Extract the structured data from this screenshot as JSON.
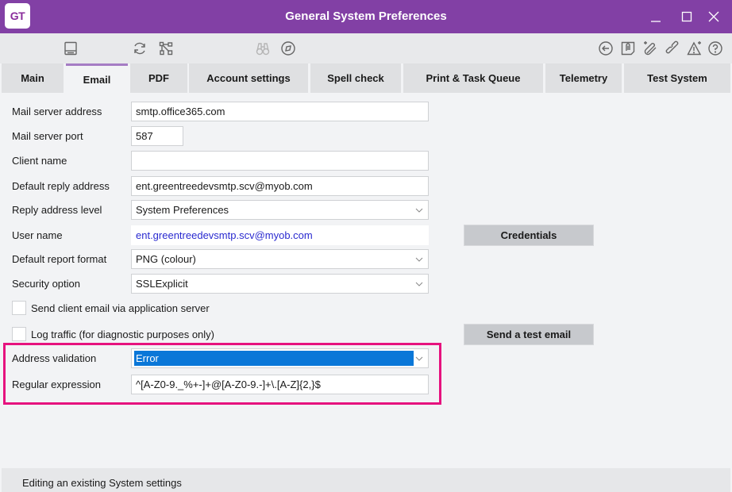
{
  "window": {
    "app_logo": "GT",
    "title": "General System Preferences",
    "controls": [
      "minimize",
      "maximize",
      "close"
    ]
  },
  "toolbar": {
    "left_icons": [
      {
        "name": "save-icon",
        "enabled": true
      },
      {
        "name": "refresh-icon",
        "enabled": true
      },
      {
        "name": "workflow-icon",
        "enabled": true
      },
      {
        "name": "binoculars-icon",
        "enabled": false
      },
      {
        "name": "compass-icon",
        "enabled": true
      }
    ],
    "right_icons": [
      {
        "name": "back-icon",
        "enabled": true
      },
      {
        "name": "attachment-doc-icon",
        "enabled": true
      },
      {
        "name": "add-attachment-icon",
        "enabled": true
      },
      {
        "name": "link-icon",
        "enabled": true
      },
      {
        "name": "add-alert-icon",
        "enabled": true
      },
      {
        "name": "help-icon",
        "enabled": true
      }
    ]
  },
  "tabs": [
    {
      "label": "Main",
      "active": false
    },
    {
      "label": "Email",
      "active": true
    },
    {
      "label": "PDF",
      "active": false
    },
    {
      "label": "Account settings",
      "active": false
    },
    {
      "label": "Spell check",
      "active": false
    },
    {
      "label": "Print & Task Queue",
      "active": false
    },
    {
      "label": "Telemetry",
      "active": false
    },
    {
      "label": "Test System",
      "active": false
    }
  ],
  "form": {
    "mail_server_address": {
      "label": "Mail server address",
      "value": "smtp.office365.com"
    },
    "mail_server_port": {
      "label": "Mail server port",
      "value": "587"
    },
    "client_name": {
      "label": "Client name",
      "value": ""
    },
    "default_reply_address": {
      "label": "Default reply address",
      "value": "ent.greentreedevsmtp.scv@myob.com"
    },
    "reply_address_level": {
      "label": "Reply address level",
      "value": "System Preferences"
    },
    "user_name": {
      "label": "User name",
      "value": "ent.greentreedevsmtp.scv@myob.com"
    },
    "default_report_format": {
      "label": "Default report format",
      "value": "PNG (colour)"
    },
    "security_option": {
      "label": "Security option",
      "value": "SSLExplicit"
    },
    "send_client_email": {
      "label": "Send client email via application server",
      "checked": false
    },
    "log_traffic": {
      "label": "Log traffic (for diagnostic purposes only)",
      "checked": false
    },
    "address_validation": {
      "label": "Address validation",
      "value": "Error"
    },
    "regular_expression": {
      "label": "Regular expression",
      "value": "^[A-Z0-9._%+-]+@[A-Z0-9.-]+\\.[A-Z]{2,}$"
    }
  },
  "buttons": {
    "credentials": "Credentials",
    "send_test_email": "Send a test email"
  },
  "status": {
    "text": "Editing an existing System settings"
  },
  "colors": {
    "titlebar": "#8240a5",
    "tab_active_accent": "#a57cc4",
    "highlight": "#e6127e",
    "selection": "#0a77d8",
    "link": "#2a2ad0"
  }
}
